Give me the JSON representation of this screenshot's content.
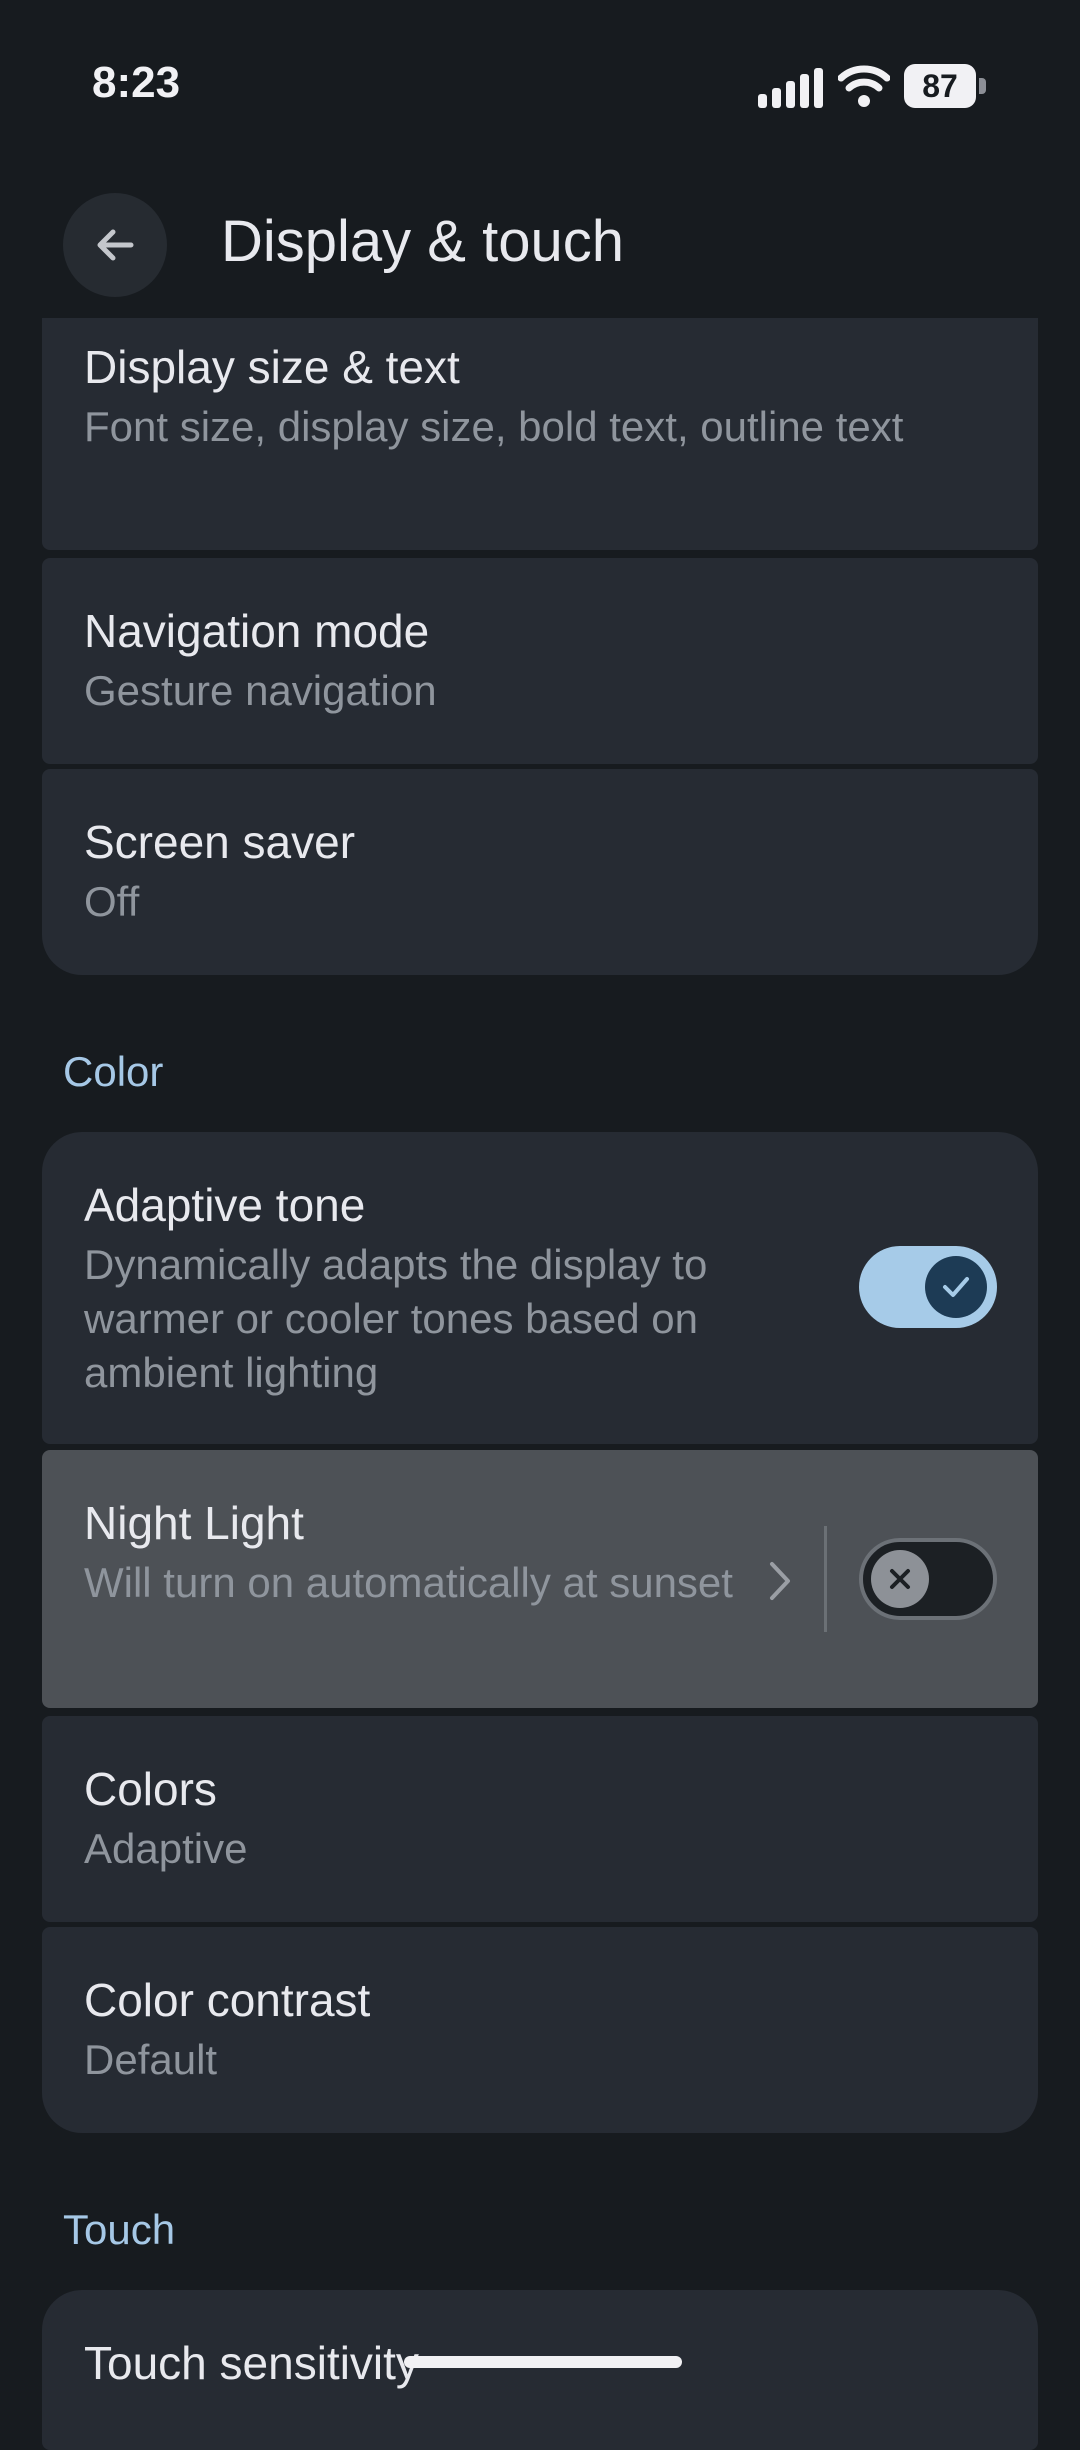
{
  "status_bar": {
    "time": "8:23",
    "battery": "87"
  },
  "header": {
    "title": "Display & touch"
  },
  "items": {
    "display_size": {
      "title": "Display size & text",
      "subtitle": "Font size, display size, bold text, outline text"
    },
    "navigation": {
      "title": "Navigation mode",
      "subtitle": "Gesture navigation"
    },
    "screen_saver": {
      "title": "Screen saver",
      "subtitle": "Off"
    }
  },
  "color_section": {
    "header": "Color",
    "adaptive_tone": {
      "title": "Adaptive tone",
      "subtitle": "Dynamically adapts the display to warmer or cooler tones based on ambient lighting",
      "enabled": true
    },
    "night_light": {
      "title": "Night Light",
      "subtitle": "Will turn on automatically at sunset",
      "enabled": false
    },
    "colors": {
      "title": "Colors",
      "subtitle": "Adaptive"
    },
    "color_contrast": {
      "title": "Color contrast",
      "subtitle": "Default"
    }
  },
  "touch_section": {
    "header": "Touch",
    "touch_sensitivity": {
      "title": "Touch sensitivity"
    }
  },
  "icons": {
    "back": "arrow-left-icon",
    "signal": "cellular-signal-icon",
    "wifi": "wifi-icon",
    "battery": "battery-icon",
    "check": "check-icon",
    "close": "close-icon",
    "chevron": "chevron-right-icon"
  },
  "colors": {
    "background": "#171b1f",
    "card": "#262b33",
    "highlight": "#4d5156",
    "accent": "#a6c8e6",
    "toggle_on_track": "#a6cbe8",
    "toggle_on_knob": "#1d3b55"
  }
}
